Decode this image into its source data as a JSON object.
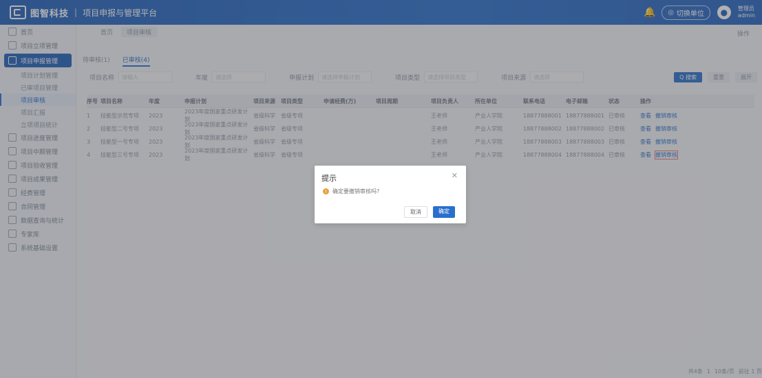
{
  "header": {
    "brand": "图智科技",
    "divider": "|",
    "platform": "项目申报与管理平台",
    "org_label": "切换单位",
    "user": {
      "name": "管理员",
      "role": "admin"
    }
  },
  "sidebar": {
    "items": [
      {
        "label": "首页"
      },
      {
        "label": "项目立项管理"
      },
      {
        "label": "项目申报管理",
        "active": true
      },
      {
        "label": "项目计划管理",
        "sub": true
      },
      {
        "label": "已审项目管理",
        "sub": true
      },
      {
        "label": "项目审核",
        "sub": true,
        "current": true
      },
      {
        "label": "项目汇报",
        "sub": true
      },
      {
        "label": "立项项目统计",
        "sub": true
      },
      {
        "label": "项目进度管理"
      },
      {
        "label": "项目中期管理"
      },
      {
        "label": "项目验收管理"
      },
      {
        "label": "项目成果管理"
      },
      {
        "label": "经费管理"
      },
      {
        "label": "合同管理"
      },
      {
        "label": "数据查询与统计"
      },
      {
        "label": "专家库"
      },
      {
        "label": "系统基础设置"
      }
    ]
  },
  "main": {
    "crumbs": [
      "首页",
      "项目审核"
    ],
    "ops_label": "操作",
    "tabs": [
      {
        "label": "待审核(1)"
      },
      {
        "label": "已审核(4)",
        "active": true
      }
    ],
    "filters": [
      {
        "label": "项目名称",
        "placeholder": "请输入"
      },
      {
        "label": "年度",
        "placeholder": "请选择"
      },
      {
        "label": "申报计划",
        "placeholder": "请选择申报计划"
      },
      {
        "label": "项目类型",
        "placeholder": "请选择项目类型"
      },
      {
        "label": "项目来源",
        "placeholder": "请选择"
      }
    ],
    "buttons": {
      "search": "Q 搜索",
      "reset": "重置",
      "more": "展开"
    },
    "table": {
      "headers": [
        "序号",
        "项目名称",
        "年度",
        "申报计划",
        "项目来源",
        "项目类型",
        "申请经费(万)",
        "项目周期",
        "项目负责人",
        "所在单位",
        "联系电话",
        "电子邮箱",
        "状态",
        "操作"
      ],
      "rows": [
        [
          "1",
          "技能型示范专项",
          "2023",
          "2023年度国家重点研发计划",
          "省级科学",
          "省级专项",
          "",
          "",
          "王老师",
          "产业人学院",
          "18877888001",
          "18877888001",
          "已审核",
          "查看",
          "撤销审核"
        ],
        [
          "2",
          "技能型二号专项",
          "2023",
          "2023年度国家重点研发计划",
          "省级科学",
          "省级专项",
          "",
          "",
          "王老师",
          "产业人学院",
          "18877888002",
          "18877888002",
          "已审核",
          "查看",
          "撤销审核"
        ],
        [
          "3",
          "技能型一号专项",
          "2023",
          "2023年度国家重点研发计划",
          "省级科学",
          "省级专项",
          "",
          "",
          "王老师",
          "产业人学院",
          "18877888003",
          "18877888003",
          "已审核",
          "查看",
          "撤销审核"
        ],
        [
          "4",
          "技能型三号专项",
          "2023",
          "2023年度国家重点研发计划",
          "省级科学",
          "省级专项",
          "",
          "",
          "王老师",
          "产业人学院",
          "18877888004",
          "18877888004",
          "已审核",
          "查看",
          "撤销审核"
        ]
      ]
    }
  },
  "footer": {
    "total": "共4条",
    "page": "1",
    "per_page": "10条/页",
    "goto": "前往 1 页"
  },
  "dialog": {
    "title": "提示",
    "message": "确定要撤销审核吗?",
    "cancel": "取消",
    "confirm": "确定"
  },
  "colors": {
    "primary": "#2a6fcc",
    "header": "#1f5fb8",
    "warning": "#e6a23c"
  }
}
